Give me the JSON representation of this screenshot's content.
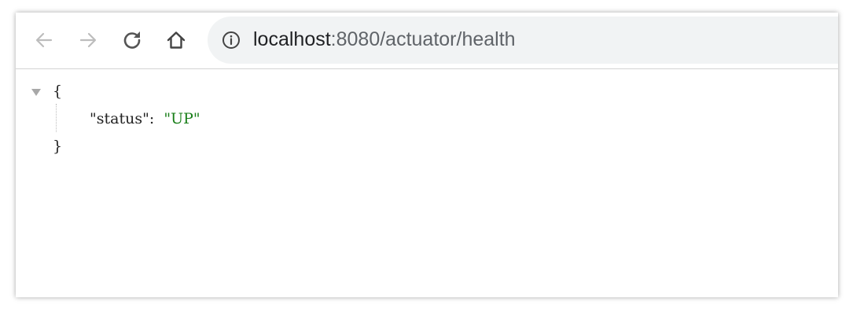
{
  "toolbar": {
    "back_icon": "arrow-left-icon",
    "forward_icon": "arrow-right-icon",
    "reload_icon": "reload-icon",
    "home_icon": "home-icon",
    "info_icon": "info-icon"
  },
  "address_bar": {
    "host": "localhost",
    "rest": ":8080/actuator/health"
  },
  "json_view": {
    "open_brace": "{",
    "close_brace": "}",
    "entries": [
      {
        "key": "\"status\"",
        "colon": ":",
        "value": "\"UP\""
      }
    ]
  },
  "colors": {
    "string_value": "#1a7f1a",
    "omnibox_bg": "#f1f3f4"
  }
}
